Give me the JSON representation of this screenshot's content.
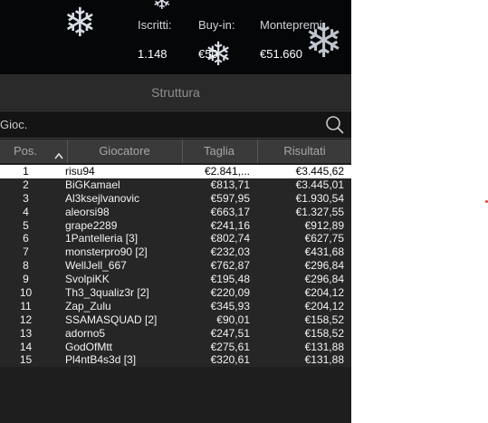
{
  "stats": {
    "registered_label": "Iscritti:",
    "registered_value": "1.148",
    "buyin_label": "Buy-in:",
    "buyin_value": "€50",
    "prizepool_label": "Montepremi:",
    "prizepool_value": "€51.660"
  },
  "section_title": "Struttura",
  "search": {
    "label": "Gioc.",
    "icon": "search-icon"
  },
  "columns": {
    "pos": "Pos.",
    "player": "Giocatore",
    "stack": "Taglia",
    "result": "Risultati"
  },
  "rows": [
    {
      "pos": "1",
      "player": "risu94",
      "stack": "€2.841,...",
      "result": "€3.445,62"
    },
    {
      "pos": "2",
      "player": "BiGKamael",
      "stack": "€813,71",
      "result": "€3.445,01"
    },
    {
      "pos": "3",
      "player": "Al3ksejlvanovic",
      "stack": "€597,95",
      "result": "€1.930,54"
    },
    {
      "pos": "4",
      "player": "aleorsi98",
      "stack": "€663,17",
      "result": "€1.327,55"
    },
    {
      "pos": "5",
      "player": "grape2289",
      "stack": "€241,16",
      "result": "€912,89"
    },
    {
      "pos": "6",
      "player": "1Pantelleria [3]",
      "stack": "€802,74",
      "result": "€627,75"
    },
    {
      "pos": "7",
      "player": "monsterpro90 [2]",
      "stack": "€232,03",
      "result": "€431,68"
    },
    {
      "pos": "8",
      "player": "WellJell_667",
      "stack": "€762,87",
      "result": "€296,84"
    },
    {
      "pos": "9",
      "player": "SvolpiKK",
      "stack": "€195,48",
      "result": "€296,84"
    },
    {
      "pos": "10",
      "player": "Th3_3qualiz3r [2]",
      "stack": "€220,09",
      "result": "€204,12"
    },
    {
      "pos": "11",
      "player": "Zap_Zulu",
      "stack": "€345,93",
      "result": "€204,12"
    },
    {
      "pos": "12",
      "player": "SSAMASQUAD [2]",
      "stack": "€90,01",
      "result": "€158,52"
    },
    {
      "pos": "13",
      "player": "adorno5",
      "stack": "€247,51",
      "result": "€158,52"
    },
    {
      "pos": "14",
      "player": "GodOfMtt",
      "stack": "€275,61",
      "result": "€131,88"
    },
    {
      "pos": "15",
      "player": "Pl4ntB4s3d [3]",
      "stack": "€320,61",
      "result": "€131,88"
    }
  ],
  "colors": {
    "selected_row": "#ffffff",
    "row_bg": "#262626",
    "header_bg": "#3a3a3a"
  }
}
